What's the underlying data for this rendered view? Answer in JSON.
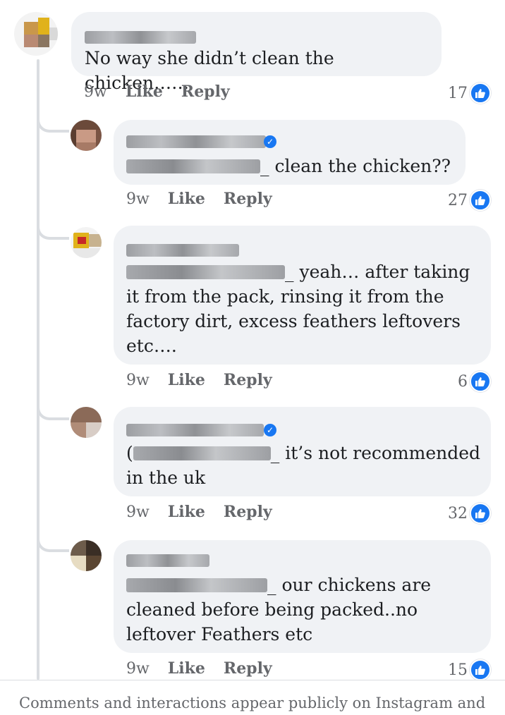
{
  "comments": [
    {
      "text": "No way she didn’t clean the chicken……",
      "time": "9w",
      "like_label": "Like",
      "reply_label": "Reply",
      "reaction_count": "17"
    },
    {
      "text_after_mention": "_ clean the chicken??",
      "time": "9w",
      "like_label": "Like",
      "reply_label": "Reply",
      "reaction_count": "27"
    },
    {
      "text_after_mention": "_ yeah… after taking",
      "text_lines": [
        "it from the pack, rinsing it from the",
        "factory dirt, excess feathers leftovers",
        "etc…."
      ],
      "time": "9w",
      "like_label": "Like",
      "reply_label": "Reply",
      "reaction_count": "6"
    },
    {
      "text_prefix": "(",
      "text_after_mention": "_ it’s not recommended",
      "text_lines": [
        "in the uk"
      ],
      "time": "9w",
      "like_label": "Like",
      "reply_label": "Reply",
      "reaction_count": "32"
    },
    {
      "text_after_mention": "_ our chickens are",
      "text_lines": [
        "cleaned before being packed..no",
        "leftover Feathers etc"
      ],
      "time": "9w",
      "like_label": "Like",
      "reply_label": "Reply",
      "reaction_count": "15"
    }
  ],
  "footer": {
    "text": "Comments and interactions appear publicly on Instagram and"
  },
  "colors": {
    "accent": "#1877f2",
    "bubble": "#f0f2f5",
    "meta_text": "#65676b"
  },
  "icons": {
    "reaction": "like-thumb-icon",
    "verified": "verified-badge-icon"
  }
}
